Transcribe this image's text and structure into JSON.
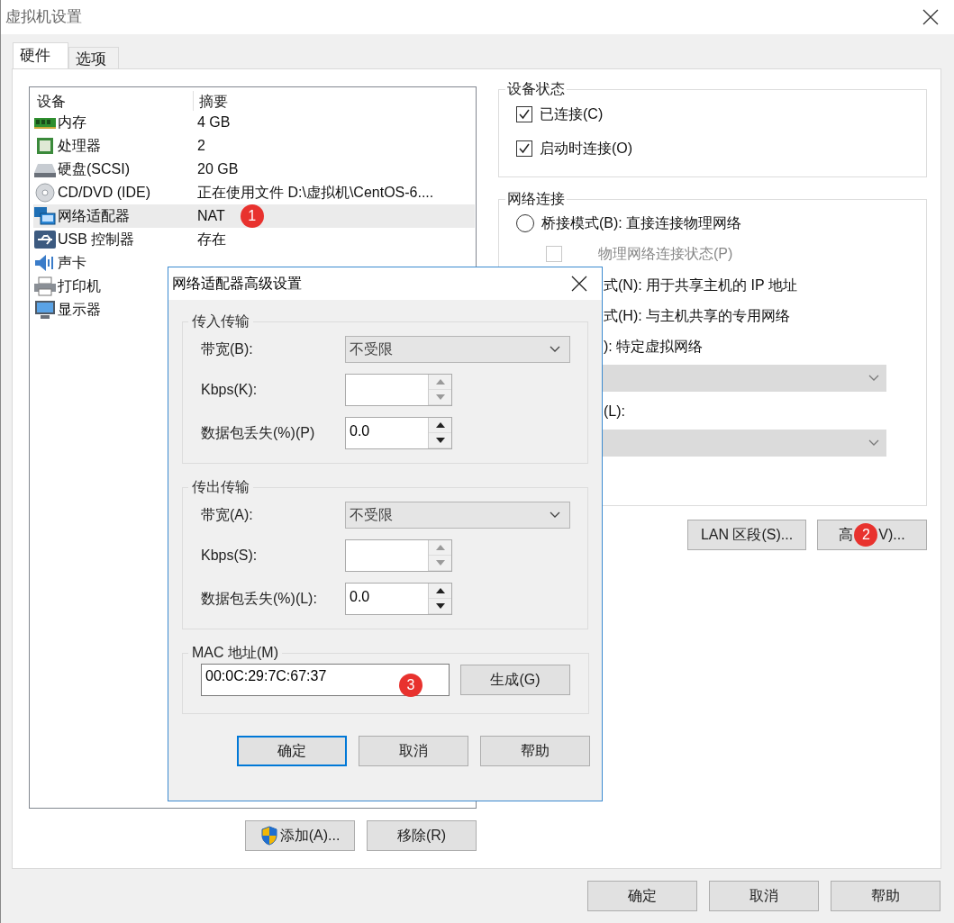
{
  "window": {
    "title": "虚拟机设置"
  },
  "tabs": [
    {
      "label": "硬件",
      "selected": true
    },
    {
      "label": "选项",
      "selected": false
    }
  ],
  "device_list": {
    "columns": [
      "设备",
      "摘要"
    ],
    "rows": [
      {
        "kind": "memory",
        "device": "内存",
        "summary": "4 GB",
        "selected": false
      },
      {
        "kind": "cpu",
        "device": "处理器",
        "summary": "2",
        "selected": false
      },
      {
        "kind": "disk",
        "device": "硬盘(SCSI)",
        "summary": "20 GB",
        "selected": false
      },
      {
        "kind": "cd",
        "device": "CD/DVD (IDE)",
        "summary": "正在使用文件 D:\\虚拟机\\CentOS-6....",
        "selected": false
      },
      {
        "kind": "network",
        "device": "网络适配器",
        "summary": "NAT",
        "selected": true,
        "badge": "1"
      },
      {
        "kind": "usb",
        "device": "USB 控制器",
        "summary": "存在",
        "selected": false
      },
      {
        "kind": "sound",
        "device": "声卡",
        "selected": false
      },
      {
        "kind": "printer",
        "device": "打印机",
        "selected": false
      },
      {
        "kind": "display",
        "device": "显示器",
        "selected": false
      }
    ]
  },
  "list_buttons": [
    {
      "label": "添加(A)...",
      "shield": true
    },
    {
      "label": "移除(R)",
      "shield": false
    }
  ],
  "device_status": {
    "title": "设备状态",
    "options": [
      {
        "label": "已连接(C)",
        "checked": true
      },
      {
        "label": "启动时连接(O)",
        "checked": true
      }
    ]
  },
  "network_connection": {
    "title": "网络连接",
    "items": [
      {
        "kind": "radio",
        "label": "桥接模式(B): 直接连接物理网络",
        "selected": false
      },
      {
        "kind": "checkbox",
        "label": "物理网络连接状态(P)",
        "checked": false,
        "disabled": true
      },
      {
        "kind": "text",
        "label": "式(N): 用于共享主机的 IP 地址"
      },
      {
        "kind": "text",
        "label": "式(H): 与主机共享的专用网络"
      },
      {
        "kind": "text",
        "label": "): 特定虚拟网络"
      },
      {
        "kind": "select",
        "disabled": true
      },
      {
        "kind": "text",
        "label": "(L):"
      },
      {
        "kind": "select",
        "disabled": true
      }
    ]
  },
  "network_buttons": [
    {
      "parts": [
        "LAN 区段(S)..."
      ]
    },
    {
      "parts": [
        "高",
        "V)..."
      ],
      "badge": "2"
    }
  ],
  "footer_buttons": [
    "确定",
    "取消",
    "帮助"
  ],
  "dialog": {
    "title": "网络适配器高级设置",
    "groups": [
      {
        "title": "传入传输",
        "rows": [
          {
            "kind": "select",
            "label": "带宽(B):",
            "value": "不受限"
          },
          {
            "kind": "spin",
            "label": "Kbps(K):",
            "disabled": true
          },
          {
            "kind": "spin",
            "label": "数据包丢失(%)(P)",
            "value": "0.0",
            "disabled": false
          }
        ]
      },
      {
        "title": "传出传输",
        "rows": [
          {
            "kind": "select",
            "label": "带宽(A):",
            "value": "不受限"
          },
          {
            "kind": "spin",
            "label": "Kbps(S):",
            "disabled": true
          },
          {
            "kind": "spin",
            "label": "数据包丢失(%)(L):",
            "value": "0.0",
            "disabled": false
          }
        ]
      }
    ],
    "mac": {
      "title": "MAC 地址(M)",
      "value": "00:0C:29:7C:67:37",
      "badge": "3",
      "button": "生成(G)"
    },
    "buttons": [
      {
        "label": "确定",
        "default": true
      },
      {
        "label": "取消",
        "default": false
      },
      {
        "label": "帮助",
        "default": false
      }
    ]
  }
}
